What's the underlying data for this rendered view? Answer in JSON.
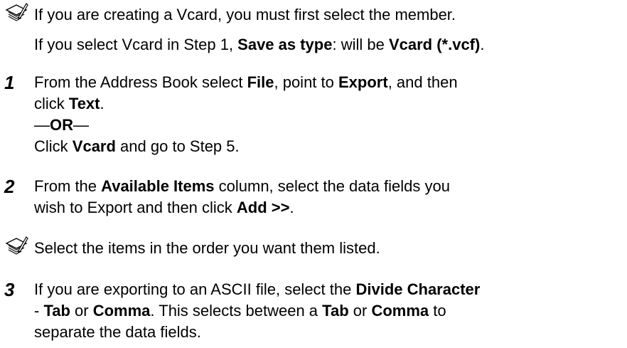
{
  "note1": {
    "line1": "If you are creating a Vcard, you must first select the member.",
    "line2_a": "If you select Vcard in Step 1, ",
    "line2_b": "Save as type",
    "line2_c": ": will be ",
    "line2_d": "Vcard (*.vcf)",
    "line2_e": "."
  },
  "step1": {
    "num": "1",
    "l1_a": "From the Address Book select ",
    "l1_b": "File",
    "l1_c": ", point to ",
    "l1_d": "Export",
    "l1_e": ", and then",
    "l2_a": "click ",
    "l2_b": "Text",
    "l2_c": ".",
    "l3_a": "—",
    "l3_b": "OR",
    "l3_c": "—",
    "l4_a": "Click ",
    "l4_b": "Vcard",
    "l4_c": " and go to Step 5."
  },
  "step2": {
    "num": "2",
    "l1_a": "From the ",
    "l1_b": "Available Items",
    "l1_c": " column, select the data fields you",
    "l2_a": "wish to Export and then click ",
    "l2_b": "Add >>",
    "l2_c": "."
  },
  "note2": {
    "line1": "Select the items in the order you want them listed."
  },
  "step3": {
    "num": "3",
    "l1_a": "If you are exporting to an ASCII file, select the ",
    "l1_b": "Divide Character",
    "l2_a": "- ",
    "l2_b": "Tab",
    "l2_c": " or ",
    "l2_d": "Comma",
    "l2_e": ". This selects between a ",
    "l2_f": "Tab",
    "l2_g": " or ",
    "l2_h": "Comma",
    "l2_i": " to",
    "l3": "separate the data fields."
  }
}
